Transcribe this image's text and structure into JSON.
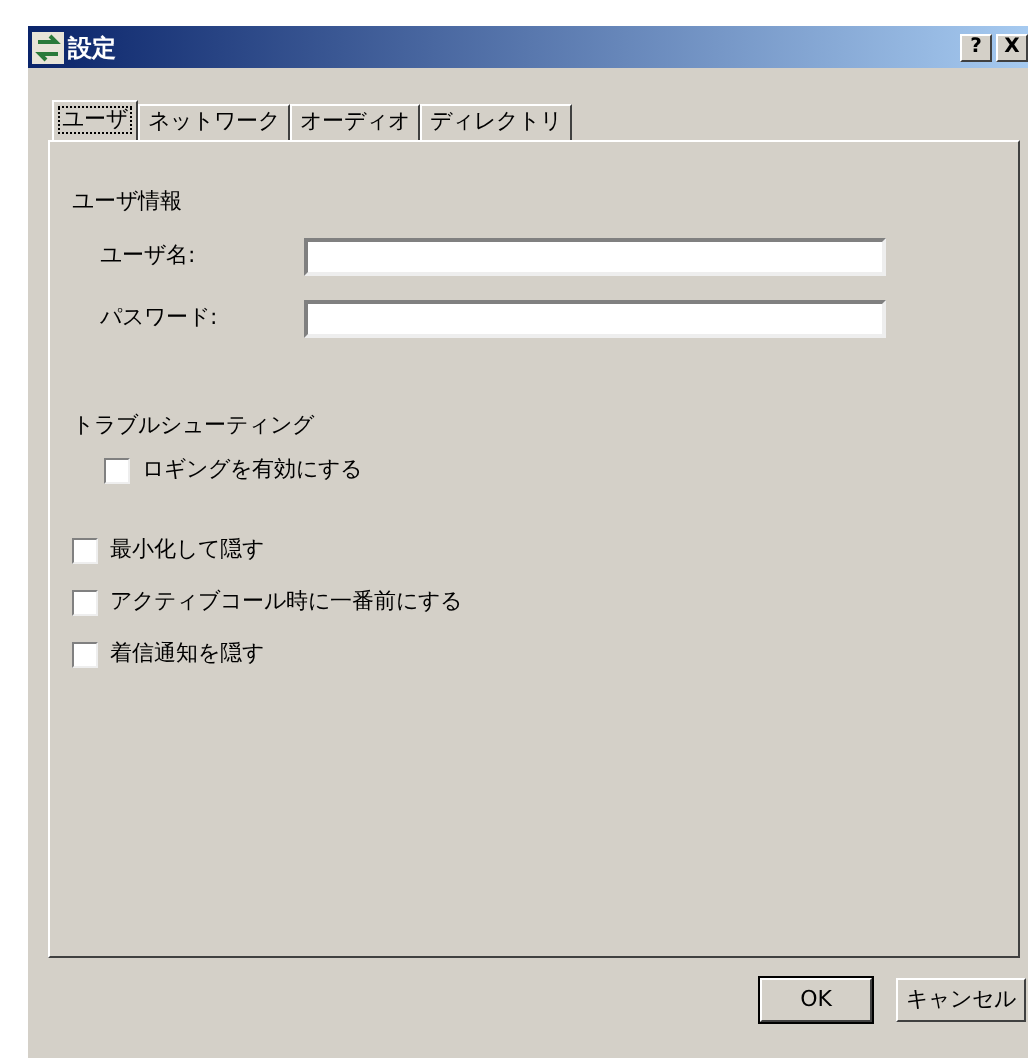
{
  "window": {
    "title": "設定",
    "title_buttons": [
      "?",
      "X"
    ]
  },
  "tabs": [
    {
      "label": "ユーザ",
      "selected": true
    },
    {
      "label": "ネットワーク",
      "selected": false
    },
    {
      "label": "オーディオ",
      "selected": false
    },
    {
      "label": "ディレクトリ",
      "selected": false
    }
  ],
  "user_info": {
    "heading": "ユーザ情報",
    "fields": [
      {
        "label": "ユーザ名:"
      },
      {
        "label": "パスワード:"
      }
    ]
  },
  "troubleshooting": {
    "heading": "トラブルシューティング",
    "options": [
      {
        "label": "ロギングを有効にする",
        "checked": false
      }
    ]
  },
  "options": [
    {
      "label": "最小化して隠す",
      "checked": false
    },
    {
      "label": "アクティブコール時に一番前にする",
      "checked": false
    },
    {
      "label": "着信通知を隠す",
      "checked": false
    }
  ],
  "buttons": [
    "OK",
    "キャンセル"
  ]
}
